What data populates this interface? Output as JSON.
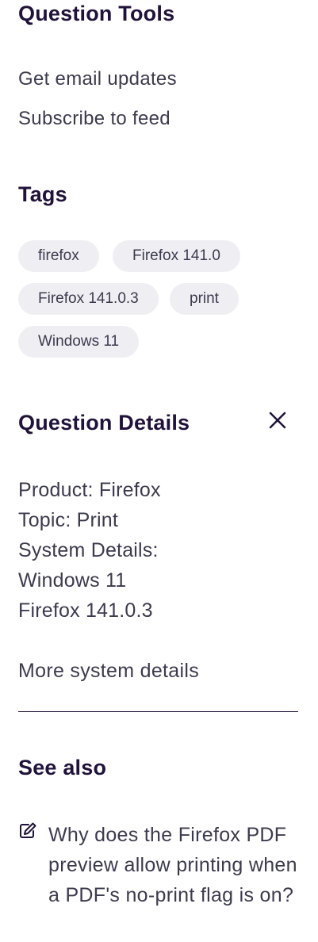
{
  "question_tools": {
    "title": "Question Tools",
    "email_updates": "Get email updates",
    "subscribe_feed": "Subscribe to feed"
  },
  "tags": {
    "title": "Tags",
    "items": [
      "firefox",
      "Firefox 141.0",
      "Firefox 141.0.3",
      "print",
      "Windows 11"
    ]
  },
  "question_details": {
    "title": "Question Details",
    "close_icon": "close-icon",
    "product": "Product: Firefox",
    "topic": "Topic: Print",
    "system_details_label": "System Details:",
    "os": "Windows 11",
    "browser": "Firefox 141.0.3",
    "more_link": "More system details"
  },
  "see_also": {
    "title": "See also",
    "item_icon": "edit-icon",
    "items": [
      {
        "text": "Why does the Firefox PDF preview allow printing when a PDF's no-print flag is on?"
      }
    ]
  },
  "colors": {
    "heading": "#20123a",
    "text": "#3b3b4f",
    "tag_bg": "#efeff3"
  }
}
